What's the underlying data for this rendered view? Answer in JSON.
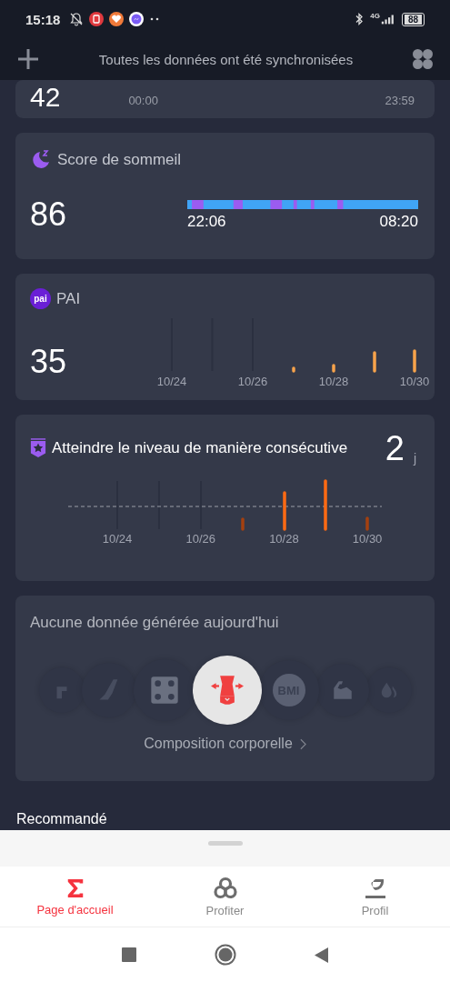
{
  "status_bar": {
    "time": "15:18",
    "network": "4G",
    "battery": "88"
  },
  "header": {
    "title": "Toutes les données ont été synchronisées"
  },
  "activity_card": {
    "value": "42",
    "start": "00:00",
    "end": "23:59"
  },
  "sleep_card": {
    "title": "Score de sommeil",
    "score": "86",
    "start": "22:06",
    "end": "08:20"
  },
  "pai_card": {
    "badge": "pai",
    "title": "PAI",
    "score": "35",
    "dates": [
      "10/24",
      "10/26",
      "10/28",
      "10/30"
    ]
  },
  "streak_card": {
    "title": "Atteindre le niveau de manière consécutive",
    "count": "2",
    "unit": "j",
    "dates": [
      "10/24",
      "10/26",
      "10/28",
      "10/30"
    ]
  },
  "body_card": {
    "message": "Aucune donnée générée aujourd'hui",
    "metrics": [
      {
        "kind": "legs",
        "selected": false
      },
      {
        "kind": "leg",
        "selected": false
      },
      {
        "kind": "grid",
        "selected": false
      },
      {
        "kind": "waist",
        "selected": true
      },
      {
        "kind": "bmi",
        "label": "BMI",
        "selected": false
      },
      {
        "kind": "muscle",
        "selected": false
      },
      {
        "kind": "water",
        "selected": false
      }
    ],
    "link": "Composition corporelle"
  },
  "section_title": "Recommandé",
  "tabs": [
    {
      "kind": "home",
      "label": "Page d'accueil",
      "selected": true
    },
    {
      "kind": "enjoy",
      "label": "Profiter",
      "selected": false
    },
    {
      "kind": "profile",
      "label": "Profil",
      "selected": false
    }
  ]
}
